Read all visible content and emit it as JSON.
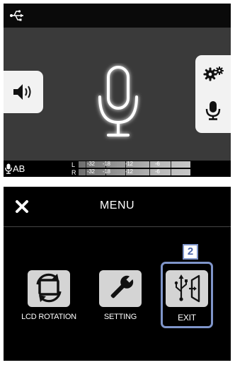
{
  "screen_top": {
    "status_bar": {
      "usb_icon": "usb-icon"
    },
    "volume_button": {
      "icon": "speaker-volume-icon"
    },
    "side_panel": {
      "settings_icon": "gear-icon",
      "mic_icon": "microphone-icon"
    },
    "center_icon": "microphone-large-icon",
    "input_indicator": {
      "icon": "microphone-icon",
      "label": "AB"
    },
    "level_meters": [
      {
        "channel": "L",
        "ticks": [
          "-32",
          "-18",
          "-12",
          "-6"
        ]
      },
      {
        "channel": "R",
        "ticks": [
          "-32",
          "-18",
          "-12",
          "-6"
        ]
      }
    ]
  },
  "screen_menu": {
    "close_icon": "close-icon",
    "title": "MENU",
    "step_badge": "2",
    "items": [
      {
        "label": "LCD ROTATION",
        "icon": "screen-rotation-icon"
      },
      {
        "label": "SETTING",
        "icon": "wrench-icon"
      },
      {
        "label": "EXIT",
        "icon": "usb-exit-icon"
      }
    ],
    "colors": {
      "highlight": "#7f95ca",
      "tile": "#d4d4d4"
    }
  }
}
